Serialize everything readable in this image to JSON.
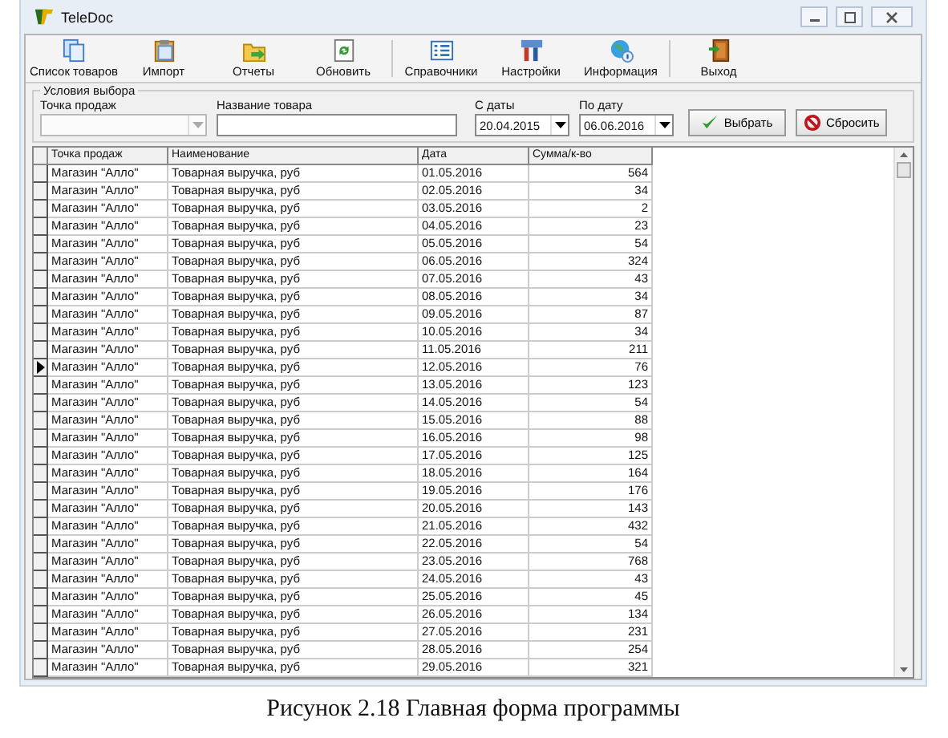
{
  "window": {
    "title": "TeleDoc"
  },
  "toolbar": {
    "groups": [
      [
        {
          "label": "Список товаров",
          "kind": "pages"
        },
        {
          "label": "Импорт",
          "kind": "clipboard"
        },
        {
          "label": "Отчеты",
          "kind": "folder"
        },
        {
          "label": "Обновить",
          "kind": "refresh"
        }
      ],
      [
        {
          "label": "Справочники",
          "kind": "list"
        },
        {
          "label": "Настройки",
          "kind": "tools"
        },
        {
          "label": "Информация",
          "kind": "globe"
        }
      ],
      [
        {
          "label": "Выход",
          "kind": "door"
        }
      ]
    ]
  },
  "filters": {
    "legend": "Условия выбора",
    "outlet": {
      "label": "Точка продаж",
      "disabled": true
    },
    "product": {
      "label": "Название товара"
    },
    "date_from": {
      "label": "С даты",
      "value": "20.04.2015"
    },
    "date_to": {
      "label": "По дату",
      "value": "06.06.2016"
    },
    "buttons": [
      {
        "label": "Выбрать",
        "kind": "check"
      },
      {
        "label": "Сбросить",
        "kind": "cancel"
      }
    ]
  },
  "table": {
    "columns": [
      "Точка продаж",
      "Наименование",
      "Дата",
      "Сумма/к-во"
    ],
    "rows": [
      {
        "cells": [
          "Магазин \"Алло\"",
          "Товарная выручка, руб",
          "01.05.2016",
          "564"
        ],
        "selected": false
      },
      {
        "cells": [
          "Магазин \"Алло\"",
          "Товарная выручка, руб",
          "02.05.2016",
          "34"
        ],
        "selected": false
      },
      {
        "cells": [
          "Магазин \"Алло\"",
          "Товарная выручка, руб",
          "03.05.2016",
          "2"
        ],
        "selected": false
      },
      {
        "cells": [
          "Магазин \"Алло\"",
          "Товарная выручка, руб",
          "04.05.2016",
          "23"
        ],
        "selected": false
      },
      {
        "cells": [
          "Магазин \"Алло\"",
          "Товарная выручка, руб",
          "05.05.2016",
          "54"
        ],
        "selected": false
      },
      {
        "cells": [
          "Магазин \"Алло\"",
          "Товарная выручка, руб",
          "06.05.2016",
          "324"
        ],
        "selected": false
      },
      {
        "cells": [
          "Магазин \"Алло\"",
          "Товарная выручка, руб",
          "07.05.2016",
          "43"
        ],
        "selected": false
      },
      {
        "cells": [
          "Магазин \"Алло\"",
          "Товарная выручка, руб",
          "08.05.2016",
          "34"
        ],
        "selected": false
      },
      {
        "cells": [
          "Магазин \"Алло\"",
          "Товарная выручка, руб",
          "09.05.2016",
          "87"
        ],
        "selected": false
      },
      {
        "cells": [
          "Магазин \"Алло\"",
          "Товарная выручка, руб",
          "10.05.2016",
          "34"
        ],
        "selected": false
      },
      {
        "cells": [
          "Магазин \"Алло\"",
          "Товарная выручка, руб",
          "11.05.2016",
          "211"
        ],
        "selected": false
      },
      {
        "cells": [
          "Магазин \"Алло\"",
          "Товарная выручка, руб",
          "12.05.2016",
          "76"
        ],
        "selected": true
      },
      {
        "cells": [
          "Магазин \"Алло\"",
          "Товарная выручка, руб",
          "13.05.2016",
          "123"
        ],
        "selected": false
      },
      {
        "cells": [
          "Магазин \"Алло\"",
          "Товарная выручка, руб",
          "14.05.2016",
          "54"
        ],
        "selected": false
      },
      {
        "cells": [
          "Магазин \"Алло\"",
          "Товарная выручка, руб",
          "15.05.2016",
          "88"
        ],
        "selected": false
      },
      {
        "cells": [
          "Магазин \"Алло\"",
          "Товарная выручка, руб",
          "16.05.2016",
          "98"
        ],
        "selected": false
      },
      {
        "cells": [
          "Магазин \"Алло\"",
          "Товарная выручка, руб",
          "17.05.2016",
          "125"
        ],
        "selected": false
      },
      {
        "cells": [
          "Магазин \"Алло\"",
          "Товарная выручка, руб",
          "18.05.2016",
          "164"
        ],
        "selected": false
      },
      {
        "cells": [
          "Магазин \"Алло\"",
          "Товарная выручка, руб",
          "19.05.2016",
          "176"
        ],
        "selected": false
      },
      {
        "cells": [
          "Магазин \"Алло\"",
          "Товарная выручка, руб",
          "20.05.2016",
          "143"
        ],
        "selected": false
      },
      {
        "cells": [
          "Магазин \"Алло\"",
          "Товарная выручка, руб",
          "21.05.2016",
          "432"
        ],
        "selected": false
      },
      {
        "cells": [
          "Магазин \"Алло\"",
          "Товарная выручка, руб",
          "22.05.2016",
          "54"
        ],
        "selected": false
      },
      {
        "cells": [
          "Магазин \"Алло\"",
          "Товарная выручка, руб",
          "23.05.2016",
          "768"
        ],
        "selected": false
      },
      {
        "cells": [
          "Магазин \"Алло\"",
          "Товарная выручка, руб",
          "24.05.2016",
          "43"
        ],
        "selected": false
      },
      {
        "cells": [
          "Магазин \"Алло\"",
          "Товарная выручка, руб",
          "25.05.2016",
          "45"
        ],
        "selected": false
      },
      {
        "cells": [
          "Магазин \"Алло\"",
          "Товарная выручка, руб",
          "26.05.2016",
          "134"
        ],
        "selected": false
      },
      {
        "cells": [
          "Магазин \"Алло\"",
          "Товарная выручка, руб",
          "27.05.2016",
          "231"
        ],
        "selected": false
      },
      {
        "cells": [
          "Магазин \"Алло\"",
          "Товарная выручка, руб",
          "28.05.2016",
          "254"
        ],
        "selected": false
      },
      {
        "cells": [
          "Магазин \"Алло\"",
          "Товарная выручка, руб",
          "29.05.2016",
          "321"
        ],
        "selected": false
      }
    ]
  },
  "caption": "Рисунок 2.18 Главная форма программы"
}
